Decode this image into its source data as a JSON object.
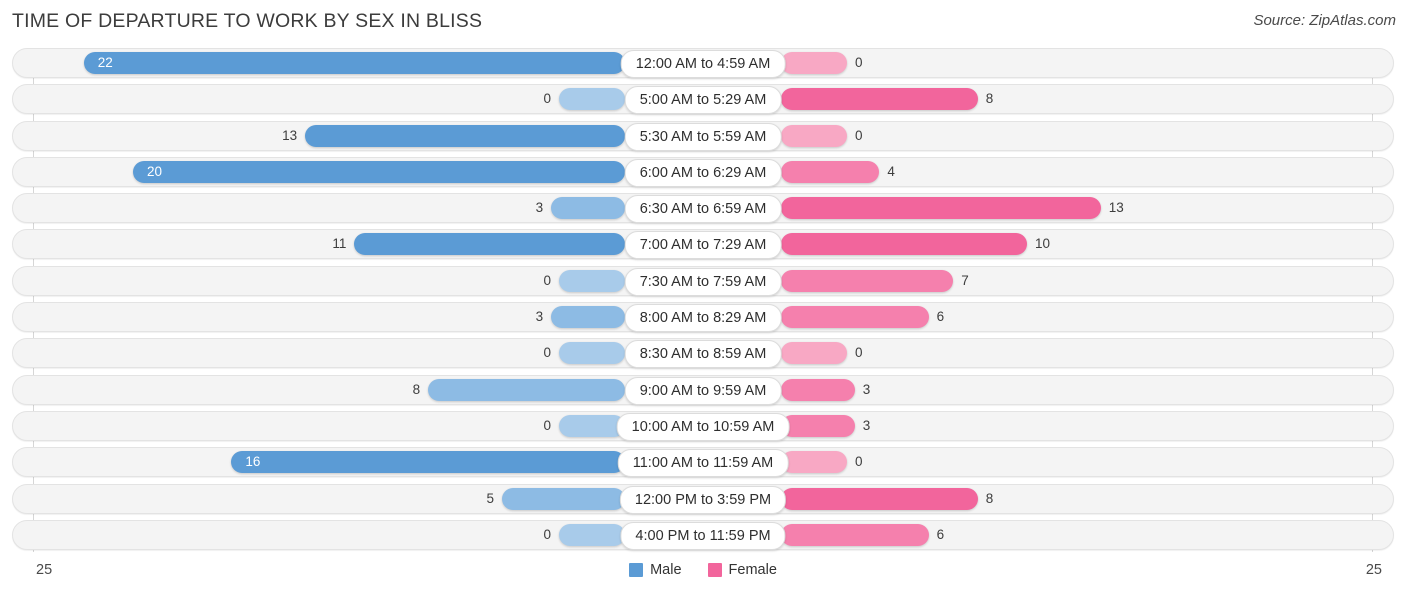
{
  "header": {
    "title": "TIME OF DEPARTURE TO WORK BY SEX IN BLISS",
    "source": "Source: ZipAtlas.com"
  },
  "legend": {
    "male_label": "Male",
    "female_label": "Female",
    "male_color": "#5b9bd5",
    "female_color": "#f2659c"
  },
  "axis": {
    "left_label": "25",
    "right_label": "25"
  },
  "colors": {
    "male_strong": "#5b9bd5",
    "male_mid": "#8dbbe4",
    "male_light": "#a8cbea",
    "female_strong": "#f2659c",
    "female_mid": "#f580ad",
    "female_light": "#f8a8c4",
    "track": "#f4f4f4",
    "gridline": "#d6d6d6"
  },
  "chart_data": {
    "type": "bar",
    "title": "TIME OF DEPARTURE TO WORK BY SEX IN BLISS",
    "subtitle": "",
    "orientation": "horizontal-diverging",
    "xlabel": "",
    "ylabel": "",
    "xlim": [
      25,
      25
    ],
    "grid": true,
    "legend_position": "bottom-center",
    "categories": [
      "12:00 AM to 4:59 AM",
      "5:00 AM to 5:29 AM",
      "5:30 AM to 5:59 AM",
      "6:00 AM to 6:29 AM",
      "6:30 AM to 6:59 AM",
      "7:00 AM to 7:29 AM",
      "7:30 AM to 7:59 AM",
      "8:00 AM to 8:29 AM",
      "8:30 AM to 8:59 AM",
      "9:00 AM to 9:59 AM",
      "10:00 AM to 10:59 AM",
      "11:00 AM to 11:59 AM",
      "12:00 PM to 3:59 PM",
      "4:00 PM to 11:59 PM"
    ],
    "series": [
      {
        "name": "Male",
        "values": [
          22,
          0,
          13,
          20,
          3,
          11,
          0,
          3,
          0,
          8,
          0,
          16,
          5,
          0
        ]
      },
      {
        "name": "Female",
        "values": [
          0,
          8,
          0,
          4,
          13,
          10,
          7,
          6,
          0,
          3,
          3,
          0,
          8,
          6
        ]
      }
    ]
  }
}
